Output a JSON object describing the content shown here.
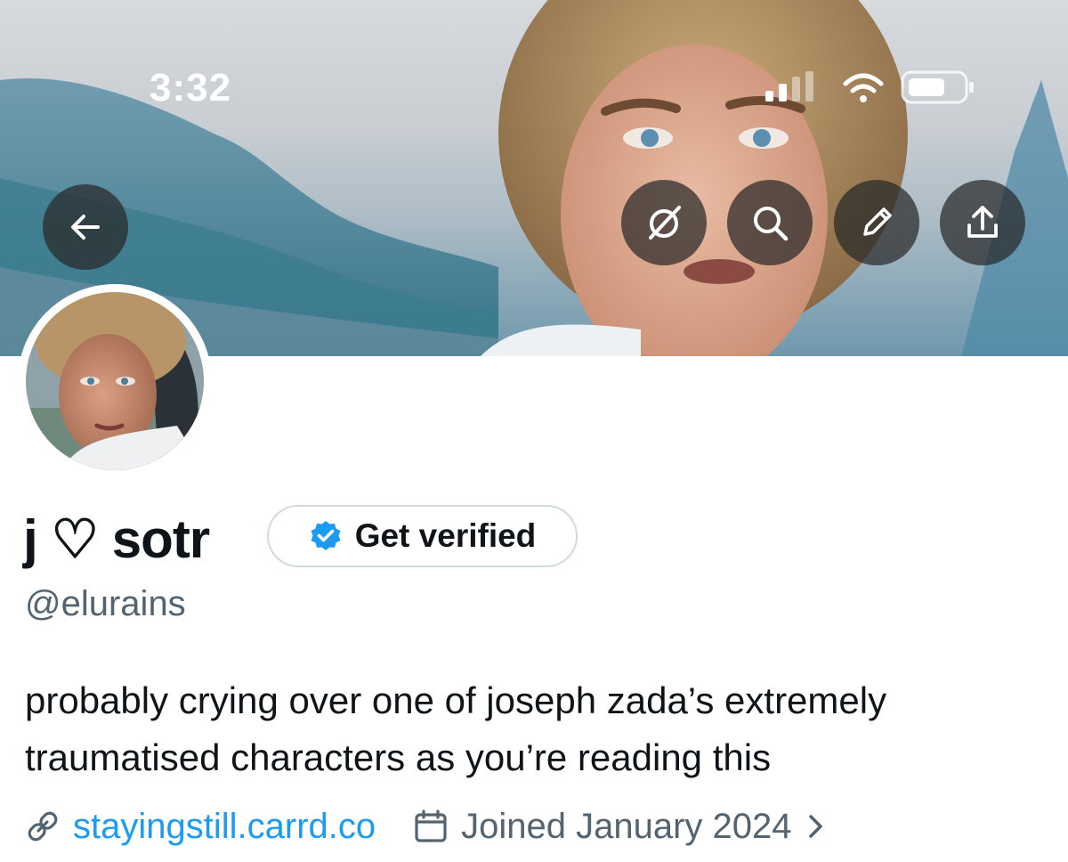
{
  "status_bar": {
    "time": "3:32",
    "icons": [
      "signal-bars-icon",
      "wifi-icon",
      "battery-icon"
    ]
  },
  "header_actions": {
    "back": "arrow-left-icon",
    "grok": "slashed-circle-icon",
    "search": "search-icon",
    "edit": "pencil-icon",
    "share": "share-upload-icon"
  },
  "profile": {
    "display_name": "j ♡ sotr",
    "handle": "@elurains",
    "get_verified_label": "Get verified",
    "bio": "probably crying over one of joseph zada’s extremely traumatised characters as you’re reading this",
    "website": "stayingstill.carrd.co",
    "joined": "Joined January 2024"
  },
  "colors": {
    "link": "#1d9bf0",
    "secondary_text": "#536471",
    "verified_badge": "#1d9bf0"
  }
}
